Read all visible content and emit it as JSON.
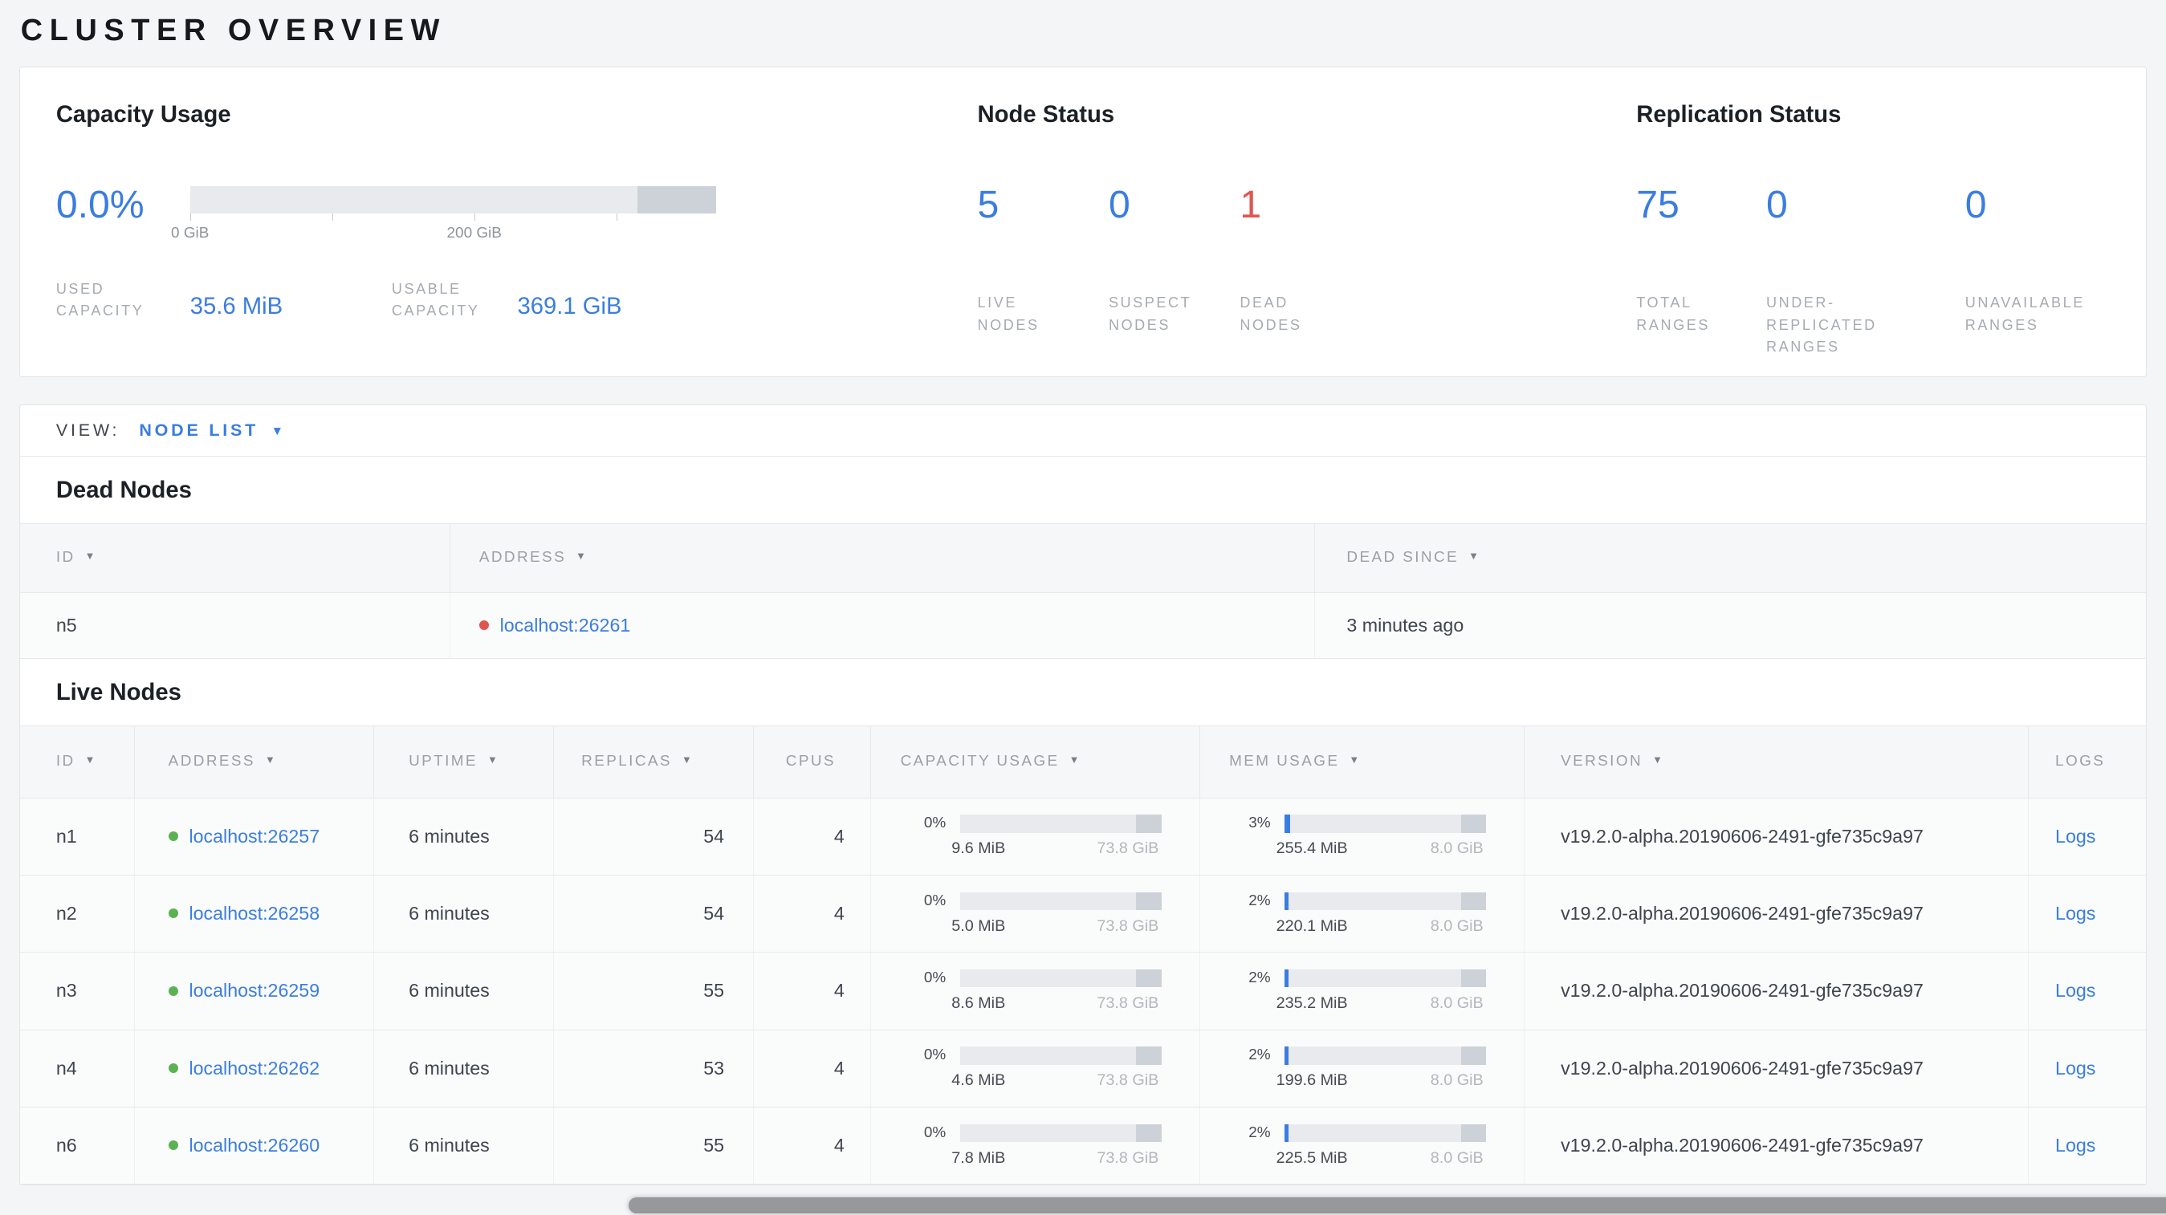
{
  "page": {
    "title": "CLUSTER OVERVIEW"
  },
  "icons": {
    "sort_desc": "▼",
    "caret_down": "▼"
  },
  "colors": {
    "accent_blue": "#3a7de2",
    "alert_red": "#e0564e",
    "live_green": "#5cb152",
    "bar_track": "#e8eaee",
    "bar_cap": "#ccd2d8"
  },
  "summary": {
    "capacity": {
      "title": "Capacity Usage",
      "percent": "0.0%",
      "fraction": 0,
      "axis_ticks": [
        "0 GiB",
        "200 GiB"
      ],
      "used_label": "USED CAPACITY",
      "used_value": "35.6 MiB",
      "usable_label": "USABLE CAPACITY",
      "usable_value": "369.1 GiB"
    },
    "node_status": {
      "title": "Node Status",
      "stats": [
        {
          "value": "5",
          "label": "LIVE NODES"
        },
        {
          "value": "0",
          "label": "SUSPECT NODES"
        },
        {
          "value": "1",
          "label": "DEAD NODES"
        }
      ]
    },
    "replication": {
      "title": "Replication Status",
      "stats": [
        {
          "value": "75",
          "label": "TOTAL RANGES"
        },
        {
          "value": "0",
          "label": "UNDER-REPLICATED RANGES"
        },
        {
          "value": "0",
          "label": "UNAVAILABLE RANGES"
        }
      ]
    }
  },
  "view_bar": {
    "label": "VIEW:",
    "selected": "NODE LIST"
  },
  "dead_nodes": {
    "title": "Dead Nodes",
    "columns": [
      "ID",
      "ADDRESS",
      "DEAD SINCE"
    ],
    "rows": [
      {
        "id": "n5",
        "address": "localhost:26261",
        "dead_since": "3 minutes ago"
      }
    ]
  },
  "live_nodes": {
    "title": "Live Nodes",
    "columns": [
      "ID",
      "ADDRESS",
      "UPTIME",
      "REPLICAS",
      "CPUS",
      "CAPACITY USAGE",
      "MEM USAGE",
      "VERSION",
      "LOGS"
    ],
    "rows": [
      {
        "id": "n1",
        "address": "localhost:26257",
        "uptime": "6 minutes",
        "replicas": "54",
        "cpus": "4",
        "capacity": {
          "percent": "0%",
          "fraction": 0,
          "used": "9.6 MiB",
          "total": "73.8 GiB"
        },
        "mem": {
          "percent": "3%",
          "fraction": 0.03,
          "used": "255.4 MiB",
          "total": "8.0 GiB"
        },
        "version": "v19.2.0-alpha.20190606-2491-gfe735c9a97",
        "logs_label": "Logs"
      },
      {
        "id": "n2",
        "address": "localhost:26258",
        "uptime": "6 minutes",
        "replicas": "54",
        "cpus": "4",
        "capacity": {
          "percent": "0%",
          "fraction": 0,
          "used": "5.0 MiB",
          "total": "73.8 GiB"
        },
        "mem": {
          "percent": "2%",
          "fraction": 0.02,
          "used": "220.1 MiB",
          "total": "8.0 GiB"
        },
        "version": "v19.2.0-alpha.20190606-2491-gfe735c9a97",
        "logs_label": "Logs"
      },
      {
        "id": "n3",
        "address": "localhost:26259",
        "uptime": "6 minutes",
        "replicas": "55",
        "cpus": "4",
        "capacity": {
          "percent": "0%",
          "fraction": 0,
          "used": "8.6 MiB",
          "total": "73.8 GiB"
        },
        "mem": {
          "percent": "2%",
          "fraction": 0.02,
          "used": "235.2 MiB",
          "total": "8.0 GiB"
        },
        "version": "v19.2.0-alpha.20190606-2491-gfe735c9a97",
        "logs_label": "Logs"
      },
      {
        "id": "n4",
        "address": "localhost:26262",
        "uptime": "6 minutes",
        "replicas": "53",
        "cpus": "4",
        "capacity": {
          "percent": "0%",
          "fraction": 0,
          "used": "4.6 MiB",
          "total": "73.8 GiB"
        },
        "mem": {
          "percent": "2%",
          "fraction": 0.02,
          "used": "199.6 MiB",
          "total": "8.0 GiB"
        },
        "version": "v19.2.0-alpha.20190606-2491-gfe735c9a97",
        "logs_label": "Logs"
      },
      {
        "id": "n6",
        "address": "localhost:26260",
        "uptime": "6 minutes",
        "replicas": "55",
        "cpus": "4",
        "capacity": {
          "percent": "0%",
          "fraction": 0,
          "used": "7.8 MiB",
          "total": "73.8 GiB"
        },
        "mem": {
          "percent": "2%",
          "fraction": 0.02,
          "used": "225.5 MiB",
          "total": "8.0 GiB"
        },
        "version": "v19.2.0-alpha.20190606-2491-gfe735c9a97",
        "logs_label": "Logs"
      }
    ]
  }
}
